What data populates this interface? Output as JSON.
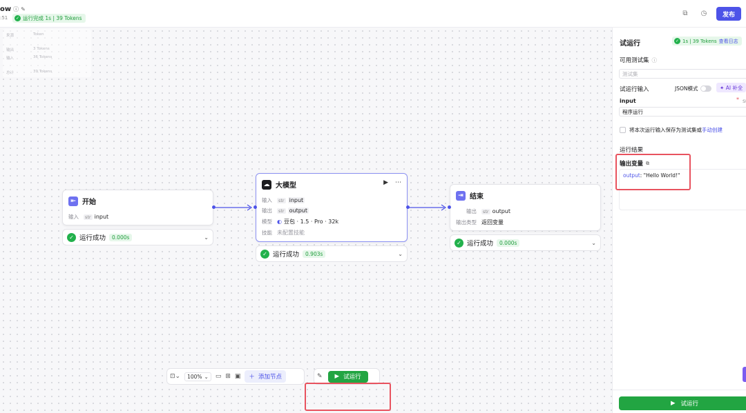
{
  "header": {
    "title": "ow",
    "time": ":51",
    "run_badge": "运行完成 1s | 39 Tokens",
    "publish_label": "发布"
  },
  "token_summary": {
    "head": [
      "来源",
      "Token"
    ],
    "rows": [
      {
        "label": "输出",
        "value": "3 Tokens"
      },
      {
        "label": "输入",
        "value": "36 Tokens"
      },
      {
        "label": "总计",
        "value": "39 Tokens"
      }
    ]
  },
  "nodes": {
    "start": {
      "title": "开始",
      "input_label": "输入",
      "input_type": "str",
      "input_name": "input",
      "status": "运行成功",
      "time": "0.000s"
    },
    "llm": {
      "title": "大模型",
      "input_label": "输入",
      "input_type": "str",
      "input_name": "input",
      "output_label": "输出",
      "output_type": "str",
      "output_name": "output",
      "model_label": "模型",
      "model_value": "豆包 · 1.5 · Pro · 32k",
      "skill_label": "技能",
      "skill_value": "未配置技能",
      "status": "运行成功",
      "time": "0.903s"
    },
    "end": {
      "title": "结束",
      "output_label": "输出",
      "output_type": "str",
      "output_name": "output",
      "type_label": "输出类型",
      "type_value": "返回变量",
      "status": "运行成功",
      "time": "0.000s"
    }
  },
  "toolbar": {
    "zoom": "100%",
    "add_node_label": "添加节点",
    "run_label": "试运行"
  },
  "panel": {
    "title": "试运行",
    "badge": "1s | 39 Tokens",
    "log_link": "查看日志",
    "testset_label": "可用测试集",
    "testset_placeholder": "测试集",
    "run_input_label": "试运行输入",
    "json_mode_label": "JSON模式",
    "ai_fill_label": "AI 补全",
    "input_name": "input",
    "required_mark": "*",
    "input_type": "St",
    "input_value": "程序运行",
    "save_text": "将本次运行输入保存为测试集或",
    "save_link": "手动创建",
    "result_label": "运行结果",
    "output_var_label": "输出变量",
    "output_key": "output",
    "output_value": ": \"Hello World!\"",
    "run_label": "试运行"
  }
}
